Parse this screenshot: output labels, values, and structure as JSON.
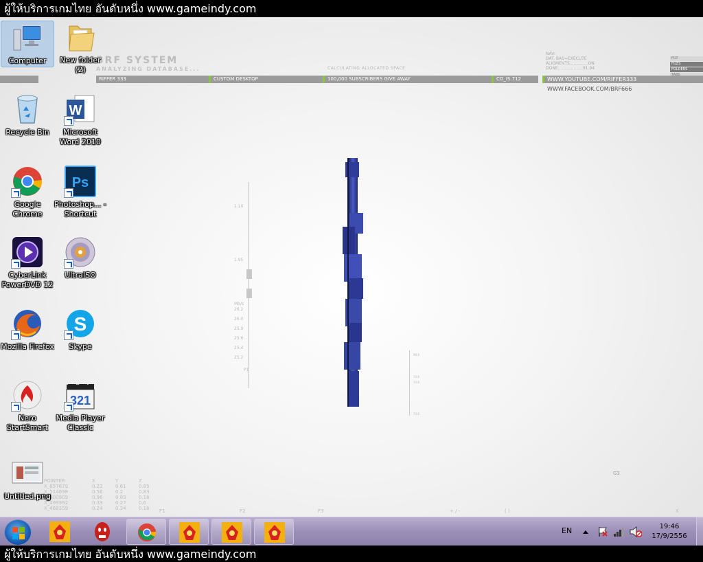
{
  "banner": {
    "text": "ผู้ให้บริการเกมไทย อันดับหนึ่ง www.gameindy.com"
  },
  "wallpaper": {
    "title": "BRF SYSTEM",
    "subtitle": "ANALYZING DATABASE...",
    "calc": "CALCULATING ALLOCATED SPACE",
    "nav_lines": [
      "NAV:",
      "DAT. BAS=EXECUTE",
      "ALIGMENTS..............ON",
      "DONE...................91.94"
    ],
    "bar": [
      "RIFFER 333",
      "CUSTOM DESKTOP",
      "100,000 SUBSCRIBERS GIVE AWAY",
      "CO_IS.712",
      "WWW.YOUTUBE.COM/RIFFER333"
    ],
    "facebook": "WWW.FACEBOOK.COM/BRF666",
    "menu": [
      "FILT",
      "FILES",
      "FOLDERS",
      "TABS"
    ],
    "scale_labels": [
      "1.10",
      "1.95",
      "Mb/s",
      "26.2",
      "26.0",
      "25.9",
      "25.6",
      "25.4",
      "25.2",
      "P1"
    ],
    "mini_labels": [
      "96.8",
      "74.8",
      "74.8",
      "74.8"
    ],
    "pointer": {
      "headers": [
        "POINTER",
        "X",
        "Y",
        "Z"
      ],
      "rows": [
        [
          "X_657679",
          "0.22",
          "0.61",
          "0.85"
        ],
        [
          "X_514698",
          "0.58",
          "0.2",
          "0.83"
        ],
        [
          "X_600909",
          "0.96",
          "0.89",
          "0.16"
        ],
        [
          "X_499992",
          "0.33",
          "0.27",
          "0.6"
        ],
        [
          "X_468359",
          "0.24",
          "0.34",
          "0.16"
        ]
      ]
    },
    "fkeys": [
      "F1",
      "F2",
      "F3",
      "+ / -",
      "( )",
      "X"
    ],
    "g3": "G3",
    "colors": {
      "accent_green": "#8cc63f",
      "structure_blue": "#3a4aa8"
    }
  },
  "desktop_icons": [
    {
      "label": "Computer",
      "icon": "computer-icon",
      "selected": true
    },
    {
      "label": "New folder (2)",
      "icon": "folder-icon"
    },
    {
      "label": "Recycle Bin",
      "icon": "recycle-bin-icon"
    },
    {
      "label": "Microsoft Word 2010",
      "icon": "word-icon"
    },
    {
      "label": "Google Chrome",
      "icon": "chrome-icon"
    },
    {
      "label": "Photoshop... - Shortcut",
      "icon": "photoshop-icon"
    },
    {
      "label": "CyberLink PowerDVD 12",
      "icon": "powerdvd-icon"
    },
    {
      "label": "UltraISO",
      "icon": "ultraiso-icon"
    },
    {
      "label": "Mozilla Firefox",
      "icon": "firefox-icon"
    },
    {
      "label": "Skype",
      "icon": "skype-icon"
    },
    {
      "label": "Nero StartSmart",
      "icon": "nero-icon"
    },
    {
      "label": "Media Player Classic",
      "icon": "media-player-classic-icon"
    },
    {
      "label": "Untitled.png",
      "icon": "image-file-icon"
    }
  ],
  "taskbar": {
    "items": [
      "start-orb",
      "game-app-icon",
      "red-face-icon",
      "chrome-icon",
      "game-app-icon",
      "game-app-icon",
      "game-app-icon"
    ],
    "language": "EN",
    "time": "19:46",
    "date": "17/9/2556"
  }
}
